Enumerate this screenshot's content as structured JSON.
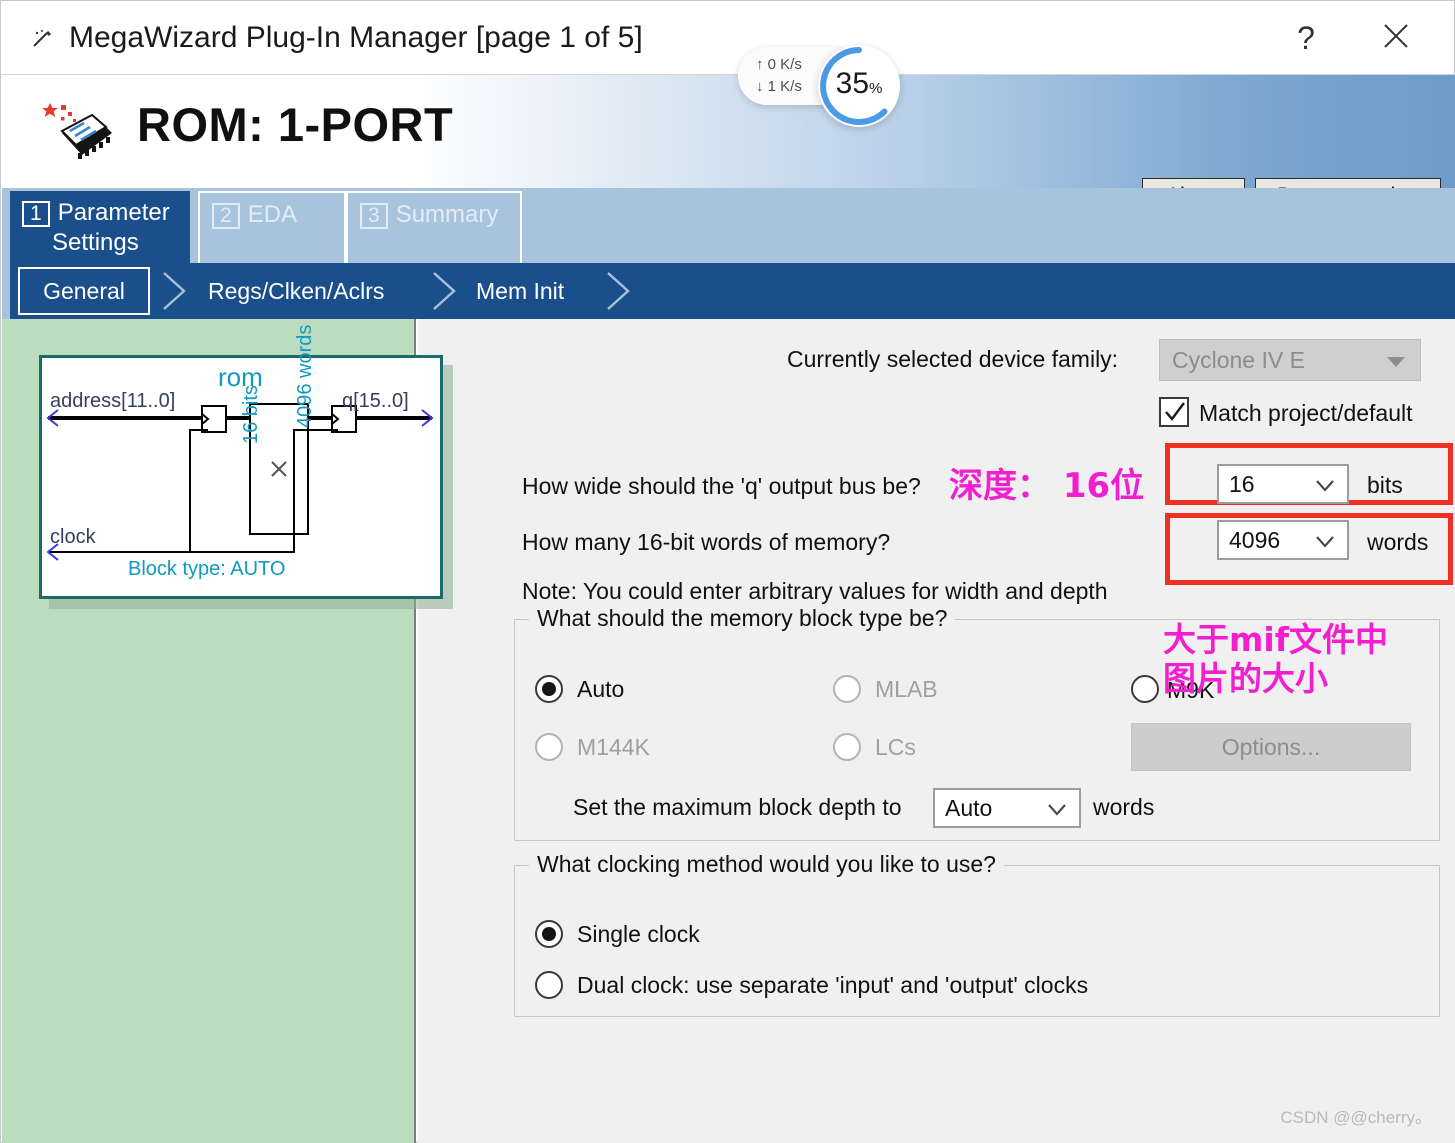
{
  "window": {
    "title": "MegaWizard Plug-In Manager [page 1 of 5]",
    "help_icon": "question-mark-icon",
    "close_icon": "close-icon",
    "wand_icon": "wand-icon"
  },
  "banner": {
    "product_title": "ROM: 1-PORT",
    "logo_icon": "altera-chip-icon",
    "about_label_accel": "A",
    "about_label_rest": "bout",
    "documentation_label_accel": "D",
    "documentation_label_rest": "ocumentation"
  },
  "tabs": [
    {
      "number": "1",
      "label_line1": "Parameter",
      "label_line2": "Settings",
      "selected": true
    },
    {
      "number": "2",
      "label_line1": "EDA",
      "label_line2": "",
      "selected": false
    },
    {
      "number": "3",
      "label_line1": "Summary",
      "label_line2": "",
      "selected": false
    }
  ],
  "subtabs": [
    {
      "label": "General",
      "selected": true
    },
    {
      "label": "Regs/Clken/Aclrs",
      "selected": false
    },
    {
      "label": "Mem Init",
      "selected": false
    }
  ],
  "rom_diagram": {
    "block_name": "rom",
    "input_port": "address[11..0]",
    "output_port": "q[15..0]",
    "clock_port": "clock",
    "memory_size_line1": "16 bits",
    "memory_size_sep": "×",
    "memory_size_line2": "4096 words",
    "block_type_note": "Block type: AUTO"
  },
  "form": {
    "device_family_label": "Currently selected device family:",
    "device_family_value": "Cyclone IV E",
    "match_project_label": "Match project/default",
    "match_project_checked": true,
    "q_width_question": "How wide should the 'q' output bus be?",
    "q_width_value": "16",
    "q_width_unit": "bits",
    "words_question": "How many 16-bit words of memory?",
    "words_value": "4096",
    "words_unit": "words",
    "note": "Note: You could enter arbitrary values for width and depth"
  },
  "block_type_group": {
    "legend": "What should the memory block type be?",
    "options": [
      {
        "label": "Auto",
        "selected": true,
        "disabled": false
      },
      {
        "label": "MLAB",
        "selected": false,
        "disabled": true
      },
      {
        "label": "M9K",
        "selected": false,
        "disabled": false
      },
      {
        "label": "M144K",
        "selected": false,
        "disabled": true
      },
      {
        "label": "LCs",
        "selected": false,
        "disabled": true
      }
    ],
    "options_button": "Options...",
    "max_depth_label": "Set the maximum block depth to",
    "max_depth_value": "Auto",
    "max_depth_unit": "words"
  },
  "clocking_group": {
    "legend": "What clocking method would you like to use?",
    "options": [
      {
        "label": "Single clock",
        "selected": true
      },
      {
        "label": "Dual clock: use separate 'input' and 'output' clocks",
        "selected": false
      }
    ]
  },
  "annotations": [
    {
      "text": "深度： 16位",
      "color": "#f21fd0"
    },
    {
      "text": "大于mif文件中\n图片的大小",
      "color": "#f21fd0"
    }
  ],
  "highlight_color": "#f03022",
  "speed_widget": {
    "upload": "↑ 0   K/s",
    "download": "↓ 1   K/s",
    "percent": "35",
    "percent_unit": "%"
  },
  "watermark": "CSDN @@cherry。"
}
